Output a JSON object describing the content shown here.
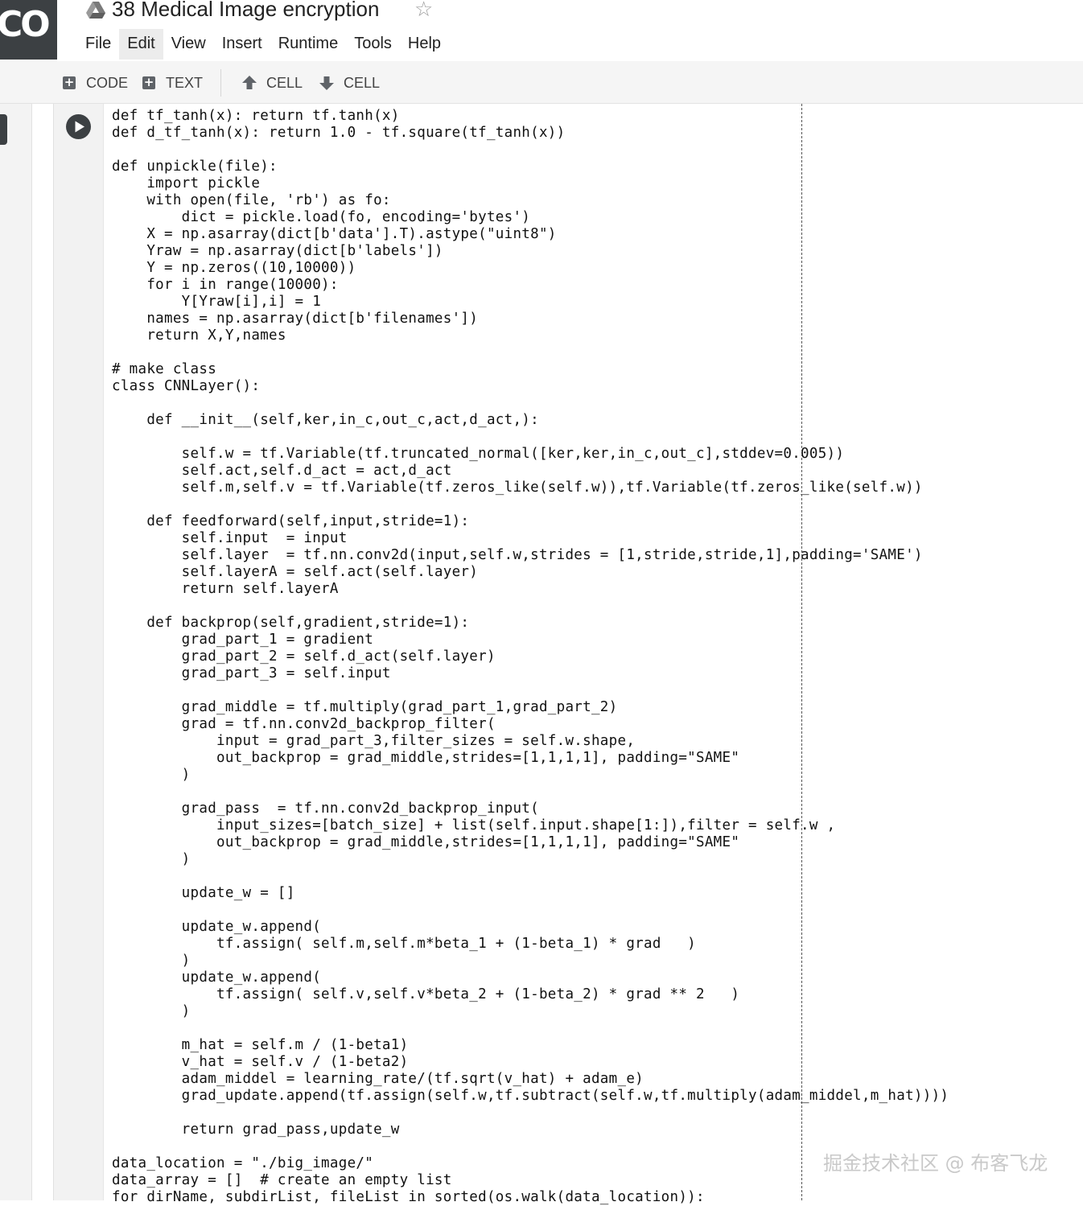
{
  "app": {
    "logo_text": "CO",
    "notebook_title": "38 Medical Image encryption",
    "star_icon": "star-outline-icon",
    "drive_icon": "google-drive-icon"
  },
  "menu": {
    "items": [
      "File",
      "Edit",
      "View",
      "Insert",
      "Runtime",
      "Tools",
      "Help"
    ],
    "active": "Edit"
  },
  "toolbar": {
    "add_code_label": "CODE",
    "add_text_label": "TEXT",
    "cell_up_label": "CELL",
    "cell_down_label": "CELL"
  },
  "cell": {
    "code_lines": [
      "def tf_tanh(x): return tf.tanh(x)",
      "def d_tf_tanh(x): return 1.0 - tf.square(tf_tanh(x))",
      "",
      "def unpickle(file):",
      "    import pickle",
      "    with open(file, 'rb') as fo:",
      "        dict = pickle.load(fo, encoding='bytes')",
      "    X = np.asarray(dict[b'data'].T).astype(\"uint8\")",
      "    Yraw = np.asarray(dict[b'labels'])",
      "    Y = np.zeros((10,10000))",
      "    for i in range(10000):",
      "        Y[Yraw[i],i] = 1",
      "    names = np.asarray(dict[b'filenames'])",
      "    return X,Y,names",
      "",
      "# make class",
      "class CNNLayer():",
      "",
      "    def __init__(self,ker,in_c,out_c,act,d_act,):",
      "",
      "        self.w = tf.Variable(tf.truncated_normal([ker,ker,in_c,out_c],stddev=0.005))",
      "        self.act,self.d_act = act,d_act",
      "        self.m,self.v = tf.Variable(tf.zeros_like(self.w)),tf.Variable(tf.zeros_like(self.w))",
      "",
      "    def feedforward(self,input,stride=1):",
      "        self.input  = input",
      "        self.layer  = tf.nn.conv2d(input,self.w,strides = [1,stride,stride,1],padding='SAME')",
      "        self.layerA = self.act(self.layer)",
      "        return self.layerA",
      "",
      "    def backprop(self,gradient,stride=1):",
      "        grad_part_1 = gradient",
      "        grad_part_2 = self.d_act(self.layer)",
      "        grad_part_3 = self.input",
      "",
      "        grad_middle = tf.multiply(grad_part_1,grad_part_2)",
      "        grad = tf.nn.conv2d_backprop_filter(",
      "            input = grad_part_3,filter_sizes = self.w.shape,",
      "            out_backprop = grad_middle,strides=[1,1,1,1], padding=\"SAME\"",
      "        )",
      "",
      "        grad_pass  = tf.nn.conv2d_backprop_input(",
      "            input_sizes=[batch_size] + list(self.input.shape[1:]),filter = self.w ,",
      "            out_backprop = grad_middle,strides=[1,1,1,1], padding=\"SAME\"",
      "        )",
      "",
      "        update_w = []",
      "",
      "        update_w.append(",
      "            tf.assign( self.m,self.m*beta_1 + (1-beta_1) * grad   )",
      "        )",
      "        update_w.append(",
      "            tf.assign( self.v,self.v*beta_2 + (1-beta_2) * grad ** 2   )",
      "        )",
      "",
      "        m_hat = self.m / (1-beta1)",
      "        v_hat = self.v / (1-beta2)",
      "        adam_middel = learning_rate/(tf.sqrt(v_hat) + adam_e)",
      "        grad_update.append(tf.assign(self.w,tf.subtract(self.w,tf.multiply(adam_middel,m_hat))))",
      "",
      "        return grad_pass,update_w",
      "",
      "data_location = \"./big_image/\"",
      "data_array = []  # create an empty list",
      "for dirName, subdirList, fileList in sorted(os.walk(data_location)):"
    ]
  },
  "watermark": "掘金技术社区 @ 布客飞龙",
  "colors": {
    "logo_bg": "#3c4043",
    "toolbar_bg": "#f5f5f5",
    "gutter_bg": "#f2f2f2"
  }
}
